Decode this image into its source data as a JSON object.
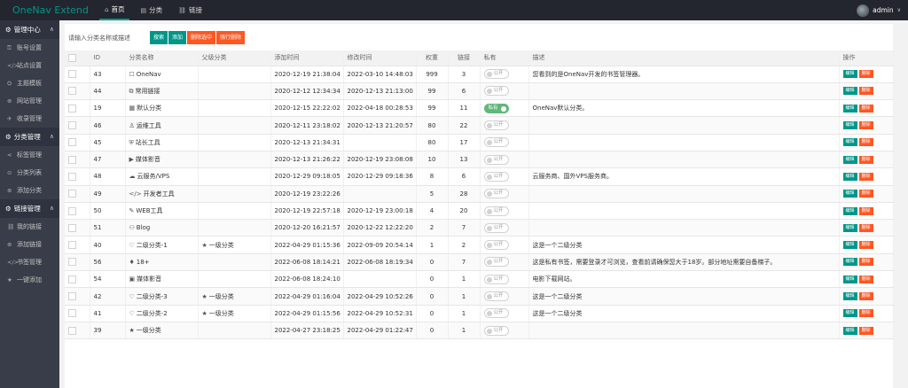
{
  "app": {
    "brand": "OneNav Extend"
  },
  "nav": [
    {
      "label": "首页",
      "icon": "⌂",
      "active": true
    },
    {
      "label": "分类",
      "icon": "▤",
      "active": false
    },
    {
      "label": "链接",
      "icon": "⛓",
      "active": false
    }
  ],
  "user": {
    "name": "admin"
  },
  "sidebar": {
    "groups": [
      {
        "title": "管理中心",
        "icon": "⚙",
        "items": [
          {
            "label": "账号设置",
            "icon": "⚿"
          },
          {
            "label": "站点设置",
            "icon": "</>"
          },
          {
            "label": "主题模板",
            "icon": "⛭"
          },
          {
            "label": "网站管理",
            "icon": "⊕"
          },
          {
            "label": "收录管理",
            "icon": "✈"
          }
        ]
      },
      {
        "title": "分类管理",
        "icon": "⚙",
        "items": [
          {
            "label": "标签管理",
            "icon": "⋖"
          },
          {
            "label": "分类列表",
            "icon": "⊙"
          },
          {
            "label": "添加分类",
            "icon": "⊕"
          }
        ]
      },
      {
        "title": "链接管理",
        "icon": "⚙",
        "items": [
          {
            "label": "我的链接",
            "icon": "⛓"
          },
          {
            "label": "添加链接",
            "icon": "⊕"
          },
          {
            "label": "书签管理",
            "icon": "</>"
          },
          {
            "label": "一键添加",
            "icon": "★"
          }
        ]
      }
    ]
  },
  "toolbar": {
    "search_placeholder": "请输入分类名称或描述",
    "search_label": "搜索",
    "add_label": "添加",
    "delete_selected_label": "删除选中",
    "force_delete_label": "强行删除"
  },
  "table": {
    "headers": [
      "ID",
      "分类名称",
      "父级分类",
      "添加时间",
      "修改时间",
      "权重",
      "链接",
      "私有",
      "描述",
      "操作"
    ],
    "switch_off_label": "公开",
    "switch_on_label": "私有",
    "edit_label": "编辑",
    "delete_label": "删除",
    "rows": [
      {
        "id": "43",
        "name": "OneNav",
        "icon": "☐",
        "parent": "",
        "parent_icon": "",
        "added": "2020-12-19 21:38:04",
        "modified": "2022-03-10 14:48:03",
        "weight": "999",
        "links": "3",
        "private": false,
        "desc": "您看到的是OneNav开发的书签管理器。"
      },
      {
        "id": "44",
        "name": "常用链接",
        "icon": "⧉",
        "parent": "",
        "parent_icon": "",
        "added": "2020-12-12 12:34:34",
        "modified": "2020-12-13 21:13:00",
        "weight": "99",
        "links": "6",
        "private": false,
        "desc": ""
      },
      {
        "id": "19",
        "name": "默认分类",
        "icon": "▦",
        "parent": "",
        "parent_icon": "",
        "added": "2020-12-15 22:22:02",
        "modified": "2022-04-18 00:28:53",
        "weight": "99",
        "links": "11",
        "private": true,
        "desc": "OneNav默认分类。"
      },
      {
        "id": "46",
        "name": "运维工具",
        "icon": "♙",
        "parent": "",
        "parent_icon": "",
        "added": "2020-12-11 23:18:02",
        "modified": "2020-12-13 21:20:57",
        "weight": "80",
        "links": "22",
        "private": false,
        "desc": ""
      },
      {
        "id": "45",
        "name": "站长工具",
        "icon": "⛨",
        "parent": "",
        "parent_icon": "",
        "added": "2020-12-13 21:34:31",
        "modified": "",
        "weight": "80",
        "links": "17",
        "private": false,
        "desc": ""
      },
      {
        "id": "47",
        "name": "媒体影音",
        "icon": "▶",
        "parent": "",
        "parent_icon": "",
        "added": "2020-12-13 21:26:22",
        "modified": "2020-12-19 23:08:08",
        "weight": "10",
        "links": "13",
        "private": false,
        "desc": ""
      },
      {
        "id": "48",
        "name": "云服务/VPS",
        "icon": "☁",
        "parent": "",
        "parent_icon": "",
        "added": "2020-12-29 09:18:05",
        "modified": "2020-12-29 09:18:36",
        "weight": "8",
        "links": "6",
        "private": false,
        "desc": "云服务商、国外VPS服务商。"
      },
      {
        "id": "49",
        "name": "开发者工具",
        "icon": "</>",
        "parent": "",
        "parent_icon": "",
        "added": "2020-12-19 23:22:26",
        "modified": "",
        "weight": "5",
        "links": "28",
        "private": false,
        "desc": ""
      },
      {
        "id": "50",
        "name": "WEB工具",
        "icon": "✎",
        "parent": "",
        "parent_icon": "",
        "added": "2020-12-19 22:57:18",
        "modified": "2020-12-19 23:00:18",
        "weight": "4",
        "links": "20",
        "private": false,
        "desc": ""
      },
      {
        "id": "51",
        "name": "Blog",
        "icon": "⚇",
        "parent": "",
        "parent_icon": "",
        "added": "2020-12-20 16:21:57",
        "modified": "2020-12-22 12:22:20",
        "weight": "2",
        "links": "7",
        "private": false,
        "desc": ""
      },
      {
        "id": "40",
        "name": "二级分类-1",
        "icon": "♡",
        "parent": "一级分类",
        "parent_icon": "★",
        "added": "2022-04-29 01:15:36",
        "modified": "2022-09-09 20:54:14",
        "weight": "1",
        "links": "2",
        "private": false,
        "desc": "这是一个二级分类"
      },
      {
        "id": "56",
        "name": "18+",
        "icon": "♦",
        "parent": "",
        "parent_icon": "",
        "added": "2022-06-08 18:14:21",
        "modified": "2022-06-08 18:19:34",
        "weight": "0",
        "links": "7",
        "private": false,
        "desc": "这是私有书签，需要登录才可浏览，查看前请确保您大于18岁。部分地址需要自备梯子。"
      },
      {
        "id": "54",
        "name": "媒体影音",
        "icon": "▣",
        "parent": "",
        "parent_icon": "",
        "added": "2022-06-08 18:24:10",
        "modified": "",
        "weight": "0",
        "links": "1",
        "private": false,
        "desc": "电影下载网站。"
      },
      {
        "id": "42",
        "name": "二级分类-3",
        "icon": "♡",
        "parent": "一级分类",
        "parent_icon": "★",
        "added": "2022-04-29 01:16:04",
        "modified": "2022-04-29 10:52:26",
        "weight": "0",
        "links": "1",
        "private": false,
        "desc": "这是一个二级分类"
      },
      {
        "id": "41",
        "name": "二级分类-2",
        "icon": "♡",
        "parent": "一级分类",
        "parent_icon": "★",
        "added": "2022-04-29 01:15:56",
        "modified": "2022-04-29 10:52:31",
        "weight": "0",
        "links": "1",
        "private": false,
        "desc": "这是一个二级分类"
      },
      {
        "id": "39",
        "name": "一级分类",
        "icon": "★",
        "parent": "",
        "parent_icon": "",
        "added": "2022-04-27 23:18:25",
        "modified": "2022-04-29 01:22:47",
        "weight": "0",
        "links": "1",
        "private": false,
        "desc": ""
      }
    ]
  }
}
